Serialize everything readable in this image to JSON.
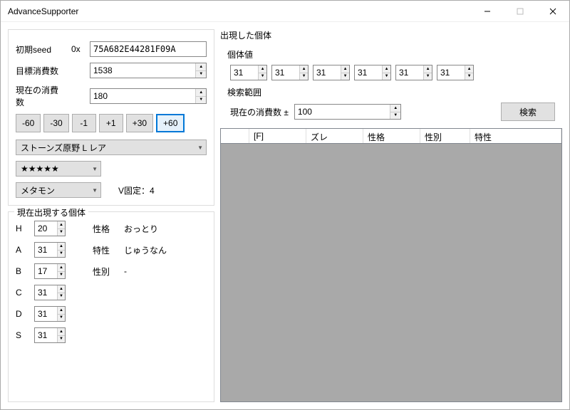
{
  "window": {
    "title": "AdvanceSupporter"
  },
  "seed": {
    "label": "初期seed",
    "prefix": "0x",
    "value": "75A682E44281F09A"
  },
  "target": {
    "label": "目標消費数",
    "value": "1538"
  },
  "current": {
    "label": "現在の消費数",
    "value": "180"
  },
  "adjust": {
    "m60": "-60",
    "m30": "-30",
    "m1": "-1",
    "p1": "+1",
    "p30": "+30",
    "p60": "+60"
  },
  "den": {
    "value": "ストーンズ原野 L レア"
  },
  "stars": {
    "value": "★★★★★"
  },
  "species": {
    "value": "メタモン"
  },
  "vfixed": {
    "label": "V固定：",
    "value": "4"
  },
  "appearing": {
    "title": "現在出現する個体",
    "H": "20",
    "A": "31",
    "B": "17",
    "C": "31",
    "D": "31",
    "S": "31",
    "nature_label": "性格",
    "nature": "おっとり",
    "ability_label": "特性",
    "ability": "じゅうなん",
    "gender_label": "性別",
    "gender": "-"
  },
  "appeared": {
    "title": "出現した個体",
    "iv_label": "個体値",
    "ivs": [
      "31",
      "31",
      "31",
      "31",
      "31",
      "31"
    ],
    "range_label": "検索範囲",
    "range_current_label": "現在の消費数 ±",
    "range_value": "100",
    "search_btn": "検索",
    "columns": {
      "blank": "",
      "f": "[F]",
      "delta": "ズレ",
      "nature": "性格",
      "gender": "性別",
      "ability": "特性"
    }
  },
  "labels": {
    "H": "H",
    "A": "A",
    "B": "B",
    "C": "C",
    "D": "D",
    "S": "S"
  }
}
